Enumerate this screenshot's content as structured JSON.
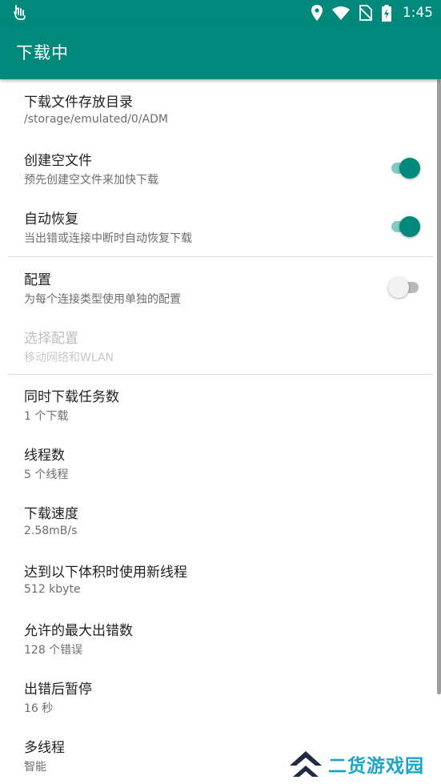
{
  "status_bar": {
    "time": "1:45",
    "icons": [
      "touch-gesture-icon",
      "location-icon",
      "wifi-icon",
      "no-sim-icon",
      "battery-charging-icon"
    ]
  },
  "app_bar": {
    "title": "下载中"
  },
  "settings": [
    {
      "title": "下载文件存放目录",
      "summary": "/storage/emulated/0/ADM"
    },
    {
      "title": "创建空文件",
      "summary": "预先创建空文件来加快下载",
      "switch": true
    },
    {
      "title": "自动恢复",
      "summary": "当出错或连接中断时自动恢复下载",
      "switch": true
    },
    {
      "title": "配置",
      "summary": "为每个连接类型使用单独的配置",
      "switch": false
    },
    {
      "title": "选择配置",
      "summary": "移动网络和WLAN",
      "enabled": false
    },
    {
      "title": "同时下载任务数",
      "summary": "1 个下载"
    },
    {
      "title": "线程数",
      "summary": "5 个线程"
    },
    {
      "title": "下载速度",
      "summary": "2.58mB/s"
    },
    {
      "title": "达到以下体积时使用新线程",
      "summary": "512 kbyte"
    },
    {
      "title": "允许的最大出错数",
      "summary": "128 个错误"
    },
    {
      "title": "出错后暂停",
      "summary": "16 秒"
    },
    {
      "title": "多线程",
      "summary": "智能"
    }
  ],
  "watermark": {
    "text": "二货游戏园"
  },
  "colors": {
    "primary": "#00897b",
    "switch_track_on": "#80cbc4",
    "switch_off_thumb": "#f1f1f1",
    "watermark": "#1aa6c9"
  }
}
